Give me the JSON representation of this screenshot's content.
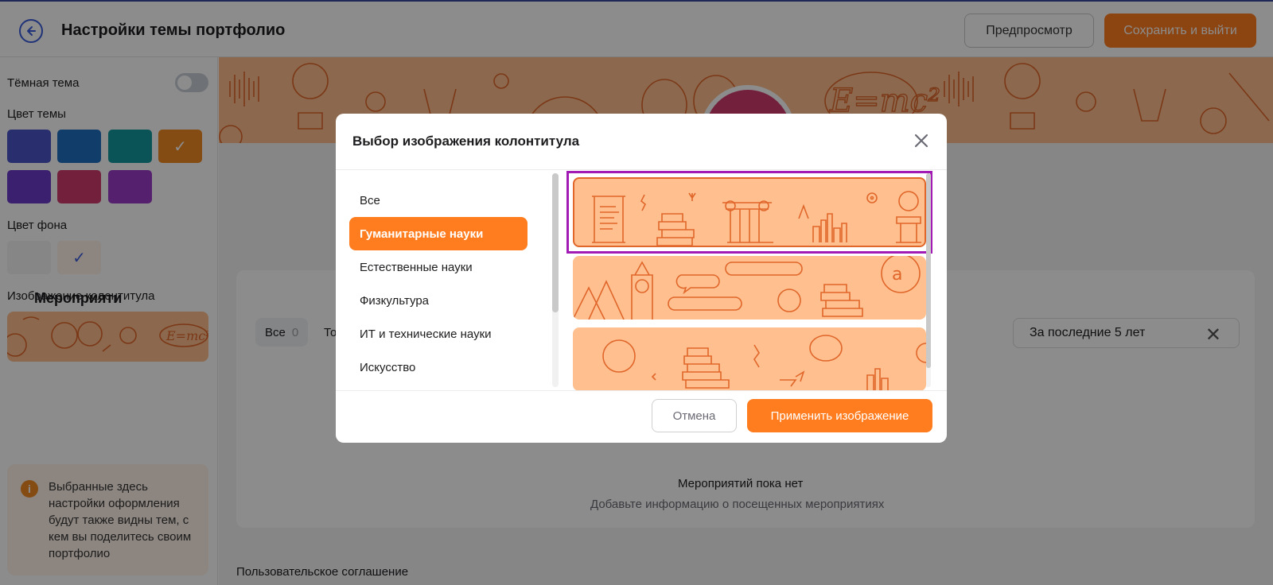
{
  "header": {
    "title": "Настройки темы портфолио",
    "preview_label": "Предпросмотр",
    "save_label": "Сохранить и выйти"
  },
  "sidebar": {
    "dark_theme_label": "Тёмная тема",
    "dark_theme_on": false,
    "theme_color_label": "Цвет темы",
    "theme_colors": [
      "#4a55c8",
      "#1f6fc4",
      "#139a9e",
      "#f08a24",
      "#6a3bc8",
      "#d23b6d",
      "#9b3bc8"
    ],
    "selected_theme_color": "#f08a24",
    "bg_color_label": "Цвет фона",
    "bg_colors": [
      "#f4f4f6",
      "#fff3e9"
    ],
    "selected_bg_color": "#fff3e9",
    "header_image_label": "Изображение колонтитула",
    "info_text": "Выбранные здесь настройки оформления будут также видны тем, с кем вы поделитесь своим портфолио"
  },
  "main": {
    "events_title": "Мероприяти",
    "chips": [
      {
        "label": "Все",
        "count": "0"
      },
      {
        "label": "То",
        "count": ""
      }
    ],
    "period_filter": "За последние 5 лет",
    "empty_title": "Мероприятий пока нет",
    "empty_subtitle": "Добавьте информацию о посещенных мероприятиях",
    "agreement": "Пользовательское соглашение"
  },
  "modal": {
    "title": "Выбор изображения колонтитула",
    "categories": [
      "Все",
      "Гуманитарные науки",
      "Естественные науки",
      "Физкультура",
      "ИТ и технические науки",
      "Искусство"
    ],
    "selected_category": "Гуманитарные науки",
    "images": [
      "humanities-1",
      "humanities-2",
      "humanities-3"
    ],
    "selected_image": "humanities-1",
    "cancel_label": "Отмена",
    "apply_label": "Применить изображение"
  },
  "colors": {
    "accent": "#ff7d1f",
    "selection_border": "#a21bb4",
    "banner_bg": "#ffbf8f"
  },
  "icons": [
    "back-arrow-icon",
    "check-icon",
    "info-icon",
    "close-icon"
  ]
}
